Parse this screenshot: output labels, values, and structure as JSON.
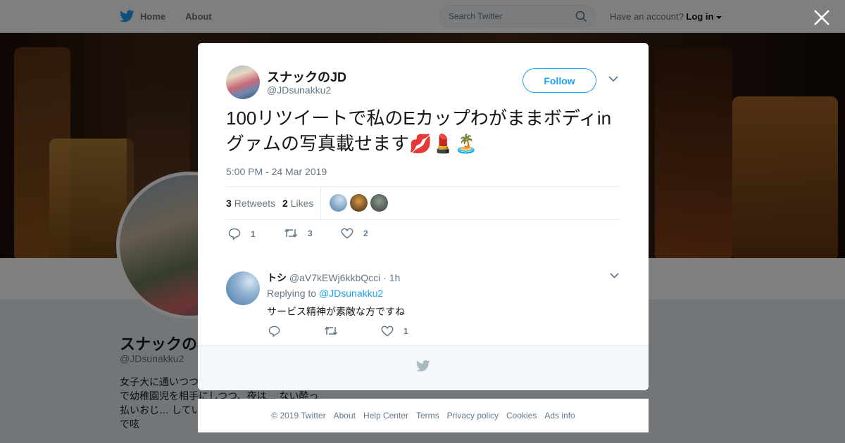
{
  "nav": {
    "home_label": "Home",
    "about_label": "About",
    "search_placeholder": "Search Twitter",
    "account_prompt": "Have an account?",
    "login_label": "Log in"
  },
  "colors": {
    "accent": "#1da1f2",
    "text": "#14171a",
    "muted": "#657786"
  },
  "profile": {
    "name": "スナックのJD",
    "handle": "@JDsunakku2",
    "bio": "女子大に通いつつ… す。 昼は保育学部の研修で幼稚園児を相手にしつつ、夜は… ない酔っ払いおじ… しています。👗🎈✨🍸 裏垢感覚で呟"
  },
  "tweet": {
    "author_name": "スナックのJD",
    "author_handle": "@JDsunakku2",
    "follow_label": "Follow",
    "text": "100リツイートで私のEカップわがままボディinグァムの写真載せます💋💄🏝️",
    "timestamp": "5:00 PM - 24 Mar 2019",
    "retweets_count": "3",
    "retweets_label": "Retweets",
    "likes_count": "2",
    "likes_label": "Likes",
    "reply_count": "1",
    "retweet_action_count": "3",
    "like_action_count": "2"
  },
  "reply": {
    "author_name": "トシ",
    "author_handle": "@aV7kEWj6kkbQcci",
    "time": "· 1h",
    "replying_prefix": "Replying to",
    "replying_to": "@JDsunakku2",
    "text": "サービス精神が素敵な方ですね",
    "like_count": "1"
  },
  "footer": {
    "links": [
      "© 2019 Twitter",
      "About",
      "Help Center",
      "Terms",
      "Privacy policy",
      "Cookies",
      "Ads info"
    ]
  },
  "icons": [
    "twitter-bird-icon",
    "search-icon",
    "close-icon",
    "chevron-down-icon",
    "reply-icon",
    "retweet-icon",
    "heart-icon"
  ]
}
